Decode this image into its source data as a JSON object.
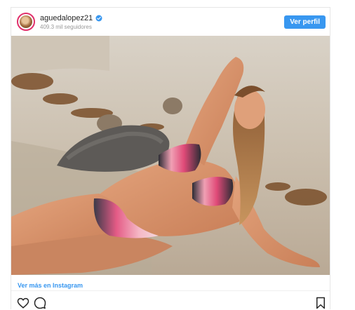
{
  "post": {
    "username": "aguedalopez21",
    "followers": "409.3 mil seguidores",
    "profile_button": "Ver perfil",
    "more_link": "Ver más en Instagram",
    "verified_icon": "verified-badge-icon",
    "image_description_icon": "photo"
  },
  "icons": {
    "like": "heart-icon",
    "comment": "comment-icon",
    "save": "bookmark-icon"
  },
  "colors": {
    "accent": "#3897f0",
    "text": "#262626",
    "muted": "#999999"
  }
}
